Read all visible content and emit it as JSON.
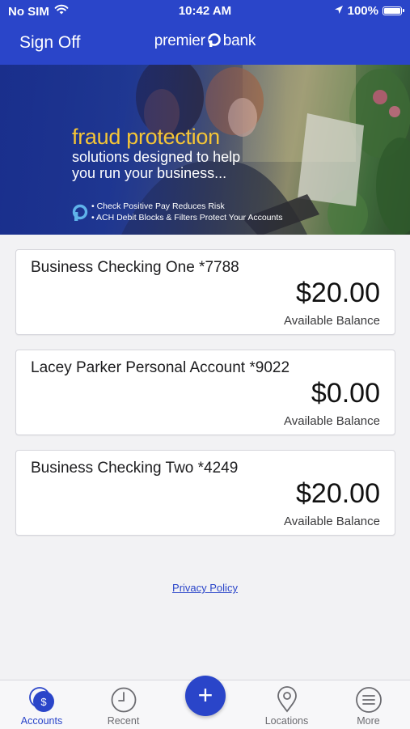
{
  "status_bar": {
    "carrier": "No SIM",
    "time": "10:42 AM",
    "battery": "100%"
  },
  "nav": {
    "sign_off_label": "Sign Off",
    "logo_left": "premier",
    "logo_right": "bank"
  },
  "banner": {
    "title": "fraud protection",
    "subtitle_line1": "solutions designed to help",
    "subtitle_line2": "you run your business...",
    "bullet1": "• Check Positive Pay Reduces Risk",
    "bullet2": "• ACH Debit Blocks & Filters Protect Your Accounts"
  },
  "accounts": [
    {
      "name": "Business Checking One *7788",
      "amount": "$20.00",
      "label": "Available Balance"
    },
    {
      "name": "Lacey Parker Personal Account *9022",
      "amount": "$0.00",
      "label": "Available Balance"
    },
    {
      "name": "Business Checking Two *4249",
      "amount": "$20.00",
      "label": "Available Balance"
    }
  ],
  "privacy_policy_label": "Privacy Policy",
  "tabs": [
    {
      "label": "Accounts",
      "icon": "accounts-dollar-icon",
      "active": true
    },
    {
      "label": "Recent",
      "icon": "clock-icon",
      "active": false
    },
    {
      "label": "",
      "icon": "plus-icon",
      "active": false
    },
    {
      "label": "Locations",
      "icon": "map-pin-icon",
      "active": false
    },
    {
      "label": "More",
      "icon": "menu-icon",
      "active": false
    }
  ],
  "fab_symbol": "+",
  "colors": {
    "brand_blue": "#2a45c9",
    "banner_title_yellow": "#f5c536",
    "background": "#f2f2f4"
  }
}
